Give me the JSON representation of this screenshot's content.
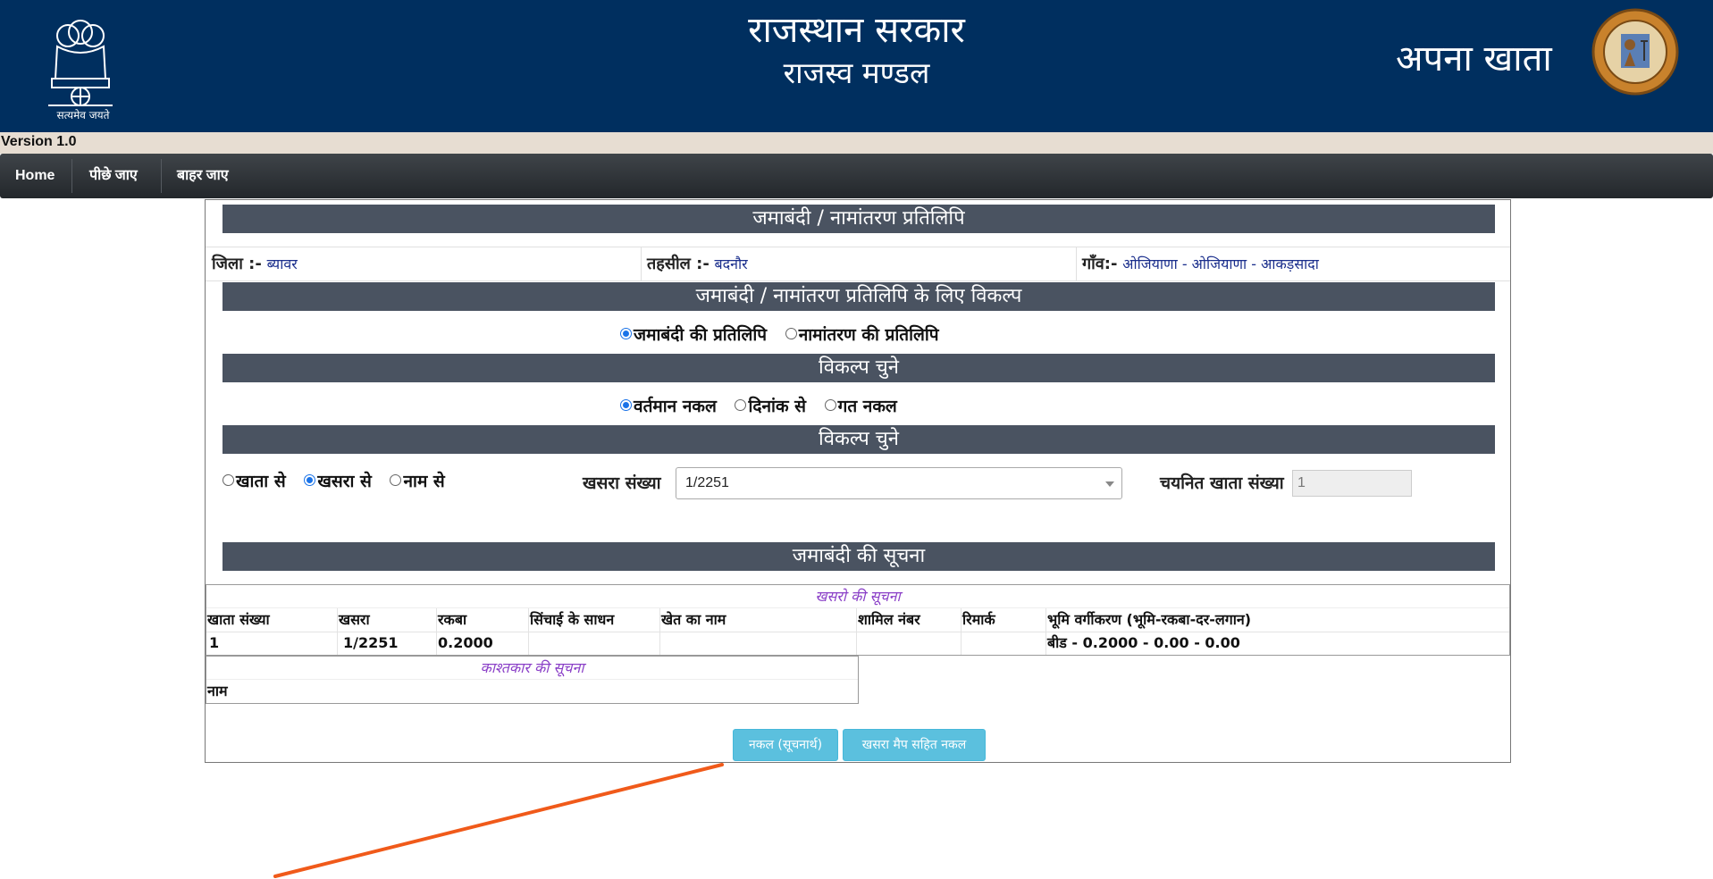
{
  "header": {
    "emblem_caption": "सत्यमेव जयते",
    "title": "राजस्थान सरकार",
    "subtitle": "राजस्व मण्डल",
    "right_title": "अपना खाता"
  },
  "version": "Version 1.0",
  "nav": {
    "home": "Home",
    "back": "पीछे जाए",
    "exit": "बाहर जाए"
  },
  "section": {
    "main_title": "जमाबंदी / नामांतरण प्रतिलिपि",
    "options_title": "जमाबंदी / नामांतरण प्रतिलिपि के लिए विकल्प",
    "choose_title_1": "विकल्प चुने",
    "choose_title_2": "विकल्प चुने",
    "info_title": "जमाबंदी की सूचना"
  },
  "location": {
    "district_label": "जिला :-",
    "district_value": "ब्यावर",
    "tehsil_label": "तहसील :-",
    "tehsil_value": "बदनौर",
    "village_label": "गाँव:-",
    "village_value": "ओजियाणा - ओजियाणा - आकड़सादा"
  },
  "copy_type": {
    "jamabandi": "जमाबंदी की प्रतिलिपि",
    "namantaran": "नामांतरण की प्रतिलिपि",
    "selected": "jamabandi"
  },
  "copy_period": {
    "current": "वर्तमान नकल",
    "by_date": "दिनांक से",
    "past": "गत नकल",
    "selected": "current"
  },
  "search_by": {
    "khata": "खाता से",
    "khasra": "खसरा से",
    "naam": "नाम से",
    "selected": "khasra"
  },
  "khasra_field": {
    "label": "खसरा संख्या",
    "value": "1/2251"
  },
  "khata_field": {
    "label": "चयनित खाता संख्या",
    "value": "1"
  },
  "khasra_table": {
    "caption": "खसरो की सूचना",
    "headers": [
      "खाता संख्या",
      "खसरा",
      "रकबा",
      "सिंचाई के साधन",
      "खेत का नाम",
      "शामिल नंबर",
      "रिमार्क",
      "भूमि वर्गीकरण (भूमि-रकबा-दर-लगान)"
    ],
    "row": [
      "1",
      "1/2251",
      "0.2000",
      "",
      "",
      "",
      "",
      "बीड - 0.2000 - 0.00 - 0.00"
    ]
  },
  "cultivator_table": {
    "caption": "काश्तकार की सूचना",
    "header": "नाम"
  },
  "buttons": {
    "copy_info": "नकल (सूचनार्थ)",
    "copy_with_map": "खसरा मैप सहित नकल"
  },
  "colors": {
    "header_bg": "#002f5f",
    "section_bar": "#4a5361",
    "button": "#5bc0de",
    "annotation_arrow": "#f05a1a"
  }
}
